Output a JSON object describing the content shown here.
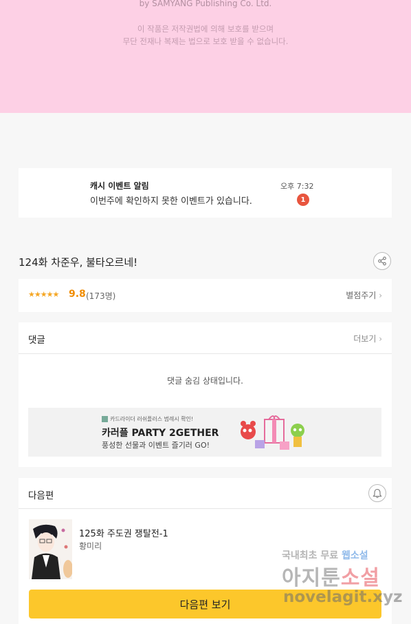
{
  "banner": {
    "publisher": "by SAMYANG Publishing Co. Ltd.",
    "copyright_line1": "이 작품은 저작권법에 의해 보호를 받으며",
    "copyright_line2": "무단 전재나 복제는 법으로 보호 받을 수 없습니다."
  },
  "notification": {
    "title": "캐시 이벤트 알림",
    "message": "이번주에 확인하지 못한 이벤트가 있습니다.",
    "time": "오후 7:32",
    "badge": "1"
  },
  "episode": {
    "title": "124화 차준우, 불타오르네!",
    "share_icon": "share-icon"
  },
  "rating": {
    "stars": "★★★★★",
    "score": "9.8",
    "count": "(173명)",
    "rate_button": "별점주기"
  },
  "comments": {
    "title": "댓글",
    "more": "더보기",
    "hidden_message": "댓글 숨김 상태입니다."
  },
  "ad": {
    "small_text": "카드라이더 러쉬플러스 범례시 확인!",
    "title": "카러플 PARTY 2GETHER",
    "subtitle": "풍성한 선물과 이벤트 즐기러 GO!"
  },
  "next_episode": {
    "section_title": "다음편",
    "episode_title": "125화 주도권 쟁탈전-1",
    "author": "황미리",
    "button": "다음편 보기",
    "bell_icon": "bell-icon"
  },
  "watermark": {
    "line1_a": "국내최초 무료",
    "line1_b": "웹소설",
    "line2_a": "아지툰",
    "line2_b": "소설",
    "line3": "novelagit.xyz"
  },
  "colors": {
    "banner_bg": "#fdd0e5",
    "accent_yellow": "#fcc72b",
    "badge_red": "#e8553e",
    "star_orange": "#f5a623"
  }
}
